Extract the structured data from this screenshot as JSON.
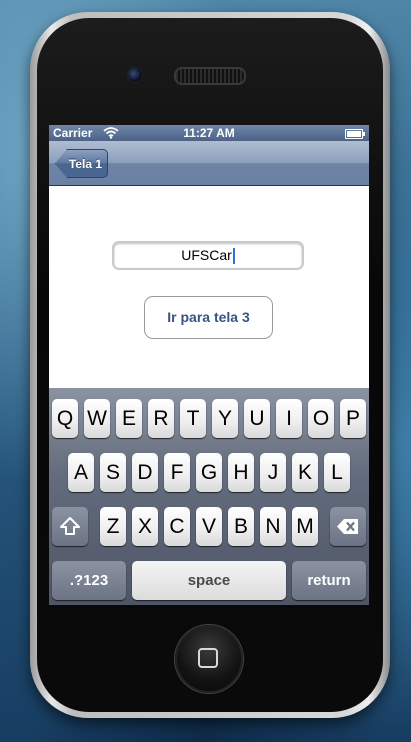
{
  "status_bar": {
    "carrier": "Carrier",
    "time": "11:27 AM"
  },
  "nav_bar": {
    "back_label": "Tela 1"
  },
  "form": {
    "text_value": "UFSCar",
    "button_label": "Ir para tela 3"
  },
  "keyboard": {
    "row1": [
      "Q",
      "W",
      "E",
      "R",
      "T",
      "Y",
      "U",
      "I",
      "O",
      "P"
    ],
    "row2": [
      "A",
      "S",
      "D",
      "F",
      "G",
      "H",
      "J",
      "K",
      "L"
    ],
    "row3": [
      "Z",
      "X",
      "C",
      "V",
      "B",
      "N",
      "M"
    ],
    "numbers_label": ".?123",
    "space_label": "space",
    "return_label": "return"
  },
  "icons": {
    "wifi": "wifi-icon",
    "battery": "battery-icon",
    "shift": "shift-icon",
    "delete": "delete-icon",
    "home": "home-button-icon",
    "camera": "camera-icon",
    "speaker": "speaker-grille-icon"
  }
}
